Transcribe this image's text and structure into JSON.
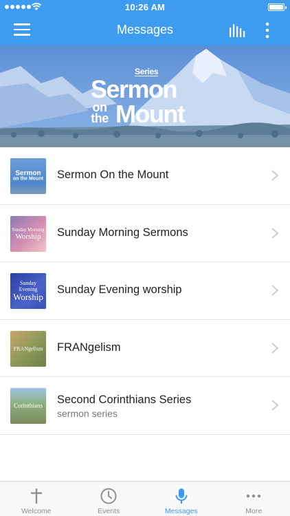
{
  "status_bar": {
    "time": "10:26 AM"
  },
  "nav": {
    "title": "Messages"
  },
  "hero": {
    "series": "Series",
    "line1": "Sermon",
    "on": "on",
    "the": "the",
    "line2": "Mount"
  },
  "list": {
    "items": [
      {
        "label": "Sermon On the Mount",
        "thumb_line1": "Sermon",
        "thumb_line2": "on the Mount"
      },
      {
        "label": "Sunday Morning Sermons",
        "thumb_line1": "Sunday Morning",
        "thumb_line2": "Worship"
      },
      {
        "label": "Sunday Evening worship",
        "thumb_line1": "Sunday Evening",
        "thumb_line2": "Worship"
      },
      {
        "label": "FRANgelism",
        "thumb_line1": "FRANgelism",
        "thumb_line2": ""
      },
      {
        "label": "Second Corinthians Series",
        "sublabel": "sermon series",
        "thumb_line1": "Corinthians",
        "thumb_line2": ""
      }
    ]
  },
  "tabs": [
    {
      "label": "Welcome",
      "icon": "cross-icon"
    },
    {
      "label": "Events",
      "icon": "clock-icon"
    },
    {
      "label": "Messages",
      "icon": "microphone-icon",
      "active": true
    },
    {
      "label": "More",
      "icon": "more-dots-icon"
    }
  ],
  "colors": {
    "accent": "#3d9bf0",
    "tab_inactive": "#8e8e93"
  }
}
